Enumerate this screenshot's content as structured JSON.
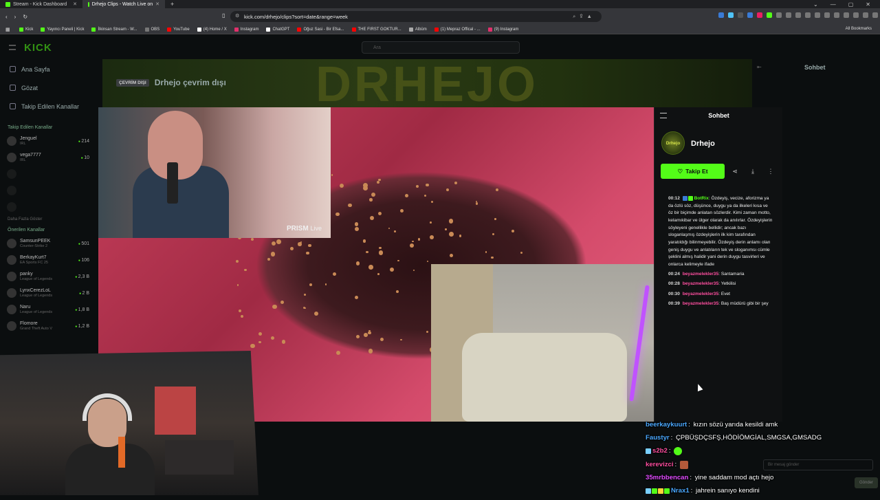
{
  "browser": {
    "tabs": [
      {
        "title": "Stream - Kick Dashboard",
        "active": false
      },
      {
        "title": "Drhejo Clips - Watch Live on",
        "active": true
      }
    ],
    "new_tab": "+",
    "url": "kick.com/drhejo/clips?sort=date&range=week",
    "bookmarks": [
      {
        "label": "Kick",
        "color": "#53fc18"
      },
      {
        "label": "Yayıncı Paneli | Kick",
        "color": "#53fc18"
      },
      {
        "label": "İlkinsan Stream - W...",
        "color": "#53fc18"
      },
      {
        "label": "OBS",
        "color": "#777777"
      },
      {
        "label": "YouTube",
        "color": "#ff0000"
      },
      {
        "label": "(4) Home / X",
        "color": "#ffffff"
      },
      {
        "label": "Instagram",
        "color": "#e1306c"
      },
      {
        "label": "ChatGPT",
        "color": "#ffffff"
      },
      {
        "label": "Oğuz Sasi - Bir Efsa...",
        "color": "#ff0000"
      },
      {
        "label": "THE FIRST GOKTUR...",
        "color": "#ff0000"
      },
      {
        "label": "Albüm",
        "color": "#aaaaaa"
      },
      {
        "label": "(1) Mepraz Offical - ...",
        "color": "#ff0000"
      },
      {
        "label": "(9) Instagram",
        "color": "#e1306c"
      }
    ],
    "all_bookmarks": "All Bookmarks"
  },
  "kick": {
    "logo": "KICK",
    "search_placeholder": "Ara",
    "nav": [
      {
        "label": "Ana Sayfa",
        "icon": "home-icon"
      },
      {
        "label": "Gözat",
        "icon": "browse-icon"
      },
      {
        "label": "Takip Edilen Kanallar",
        "icon": "heart-icon"
      }
    ],
    "followed_title": "Takip Edilen Kanallar",
    "followed": [
      {
        "name": "Jenguel",
        "game": "IRL",
        "viewers": "214"
      },
      {
        "name": "vega7777",
        "game": "IRL",
        "viewers": "10"
      }
    ],
    "show_more": "Daha Fazla Göster",
    "recommended_title": "Önerilen Kanallar",
    "recommended": [
      {
        "name": "SamsunPEEK",
        "game": "Counter-Strike 2",
        "viewers": "501"
      },
      {
        "name": "BerkayKurt7",
        "game": "EA Sports FC 25",
        "viewers": "106"
      },
      {
        "name": "panky",
        "game": "League of Legends",
        "viewers": "2,3 B"
      },
      {
        "name": "LynxCerezLoL",
        "game": "League of Legends",
        "viewers": "2 B"
      },
      {
        "name": "Naru",
        "game": "League of Legends",
        "viewers": "1,8 B"
      },
      {
        "name": "Flomore",
        "game": "Grand Theft Auto V",
        "viewers": "1,2 B"
      }
    ],
    "banner_title": "DRHEJO",
    "offline_badge": "ÇEVRİM DIŞI",
    "offline_text": "Drhejo çevrim dışı",
    "bg_chat_title": "Sohbet"
  },
  "clip_panel": {
    "title": "Sohbet",
    "channel_name": "Drhejo",
    "avatar_text": "Drhejo",
    "follow_label": "Takip Et",
    "messages": [
      {
        "time": "00:12",
        "user": "BotRix",
        "color": "#53fc18",
        "badges": [
          "#3a7bd5",
          "#53fc18"
        ],
        "text": "Özdeyiş, vecize, aforizma ya da özlü söz, düşünce, duygu ya da ilkeleri kısa ve öz bir biçimde anlatan sözlerdir. Kimi zaman motto, kelamıkibar ve ülger olarak da anılırlar. Özdeyişlerin söyleyeni genellikle bellidir; ancak bazı sloganlaşmış özdeyişlerin ilk kim tarafından yaratıldığı bilinmeyebilir.  Özdeyiş derin anlamı olan geniş duygu ve anlatıların tek ve sloganımsı cümle şeklini almış halidir yani derin duygu tasvirleri ve onlarca kelimeyle ifade"
      },
      {
        "time": "00:24",
        "user": "beyazmelekler35",
        "color": "#ff4fa0",
        "badges": [],
        "text": "Santamaria"
      },
      {
        "time": "00:28",
        "user": "beyazmelekler35",
        "color": "#ff4fa0",
        "badges": [],
        "text": "Yetkilisi"
      },
      {
        "time": "00:30",
        "user": "beyazmelekler35",
        "color": "#ff4fa0",
        "badges": [],
        "text": "Evet"
      },
      {
        "time": "00:39",
        "user": "beyazmelekler35",
        "color": "#ff4fa0",
        "badges": [],
        "text": "Baş müdürü gibi bir şey"
      }
    ]
  },
  "clip_video": {
    "watermark_brand": "PRISM",
    "watermark_suffix": "Live"
  },
  "stream_chat": [
    {
      "user": "beerkaykuurt",
      "color": "#4aa8ff",
      "badges": [],
      "text": "kızın sözü yarıda kesildi amk",
      "emote": null
    },
    {
      "user": "Faustyr",
      "color": "#4aa8ff",
      "badges": [],
      "text": "ÇPBÜŞDÇSFŞ,HÖDİÖMGİAL,SMGSA,GMSADG",
      "emote": null
    },
    {
      "user": "s2b2",
      "color": "#ff4fa0",
      "badges": [
        "#7ad0ff"
      ],
      "text": "",
      "emote": "#53fc18"
    },
    {
      "user": "kerevizci",
      "color": "#ff4fa0",
      "badges": [],
      "text": "",
      "emote": "#b35a3a"
    },
    {
      "user": "35mrbbencan",
      "color": "#e04bff",
      "badges": [],
      "text": "yine saddam mod açtı hejo",
      "emote": null
    },
    {
      "user": "Nrax1",
      "color": "#4aa8ff",
      "badges": [
        "#7ad0ff",
        "#53fc18",
        "#ffd23a",
        "#53fc18"
      ],
      "text": "jahrein sanıyo kendini",
      "emote": null
    }
  ],
  "send_label": "Gönder",
  "chat_input_placeholder": "Bir mesaj gönder"
}
